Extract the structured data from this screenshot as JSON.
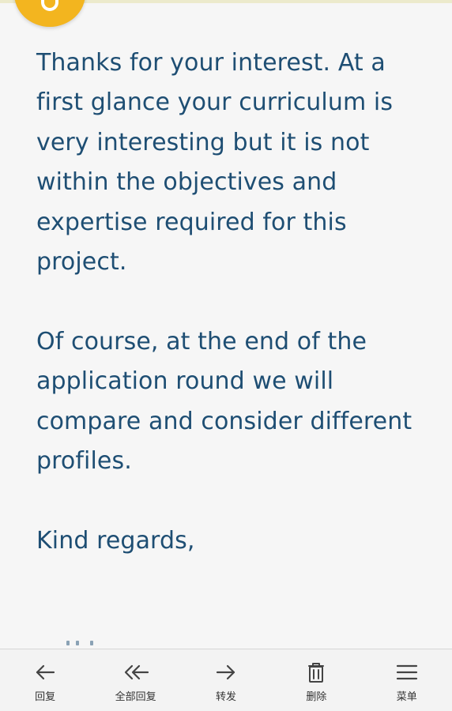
{
  "message": {
    "paragraphs": [
      "Thanks for your interest. At a first glance your curriculum is very interesting but it is not within the objectives and expertise required for this project.",
      "Of course, at the end of the application round we will compare and consider different profiles.",
      "Kind regards,"
    ]
  },
  "toolbar": {
    "items": [
      {
        "label": "回复",
        "icon": "arrow-left-icon"
      },
      {
        "label": "全部回复",
        "icon": "double-arrow-left-icon"
      },
      {
        "label": "转发",
        "icon": "arrow-right-icon"
      },
      {
        "label": "删除",
        "icon": "trash-icon"
      },
      {
        "label": "菜单",
        "icon": "menu-icon"
      }
    ]
  },
  "colors": {
    "message_text": "#1e4e73",
    "avatar": "#f3b51f",
    "toolbar_background": "#f3f3f3",
    "toolbar_icon": "#444444"
  }
}
